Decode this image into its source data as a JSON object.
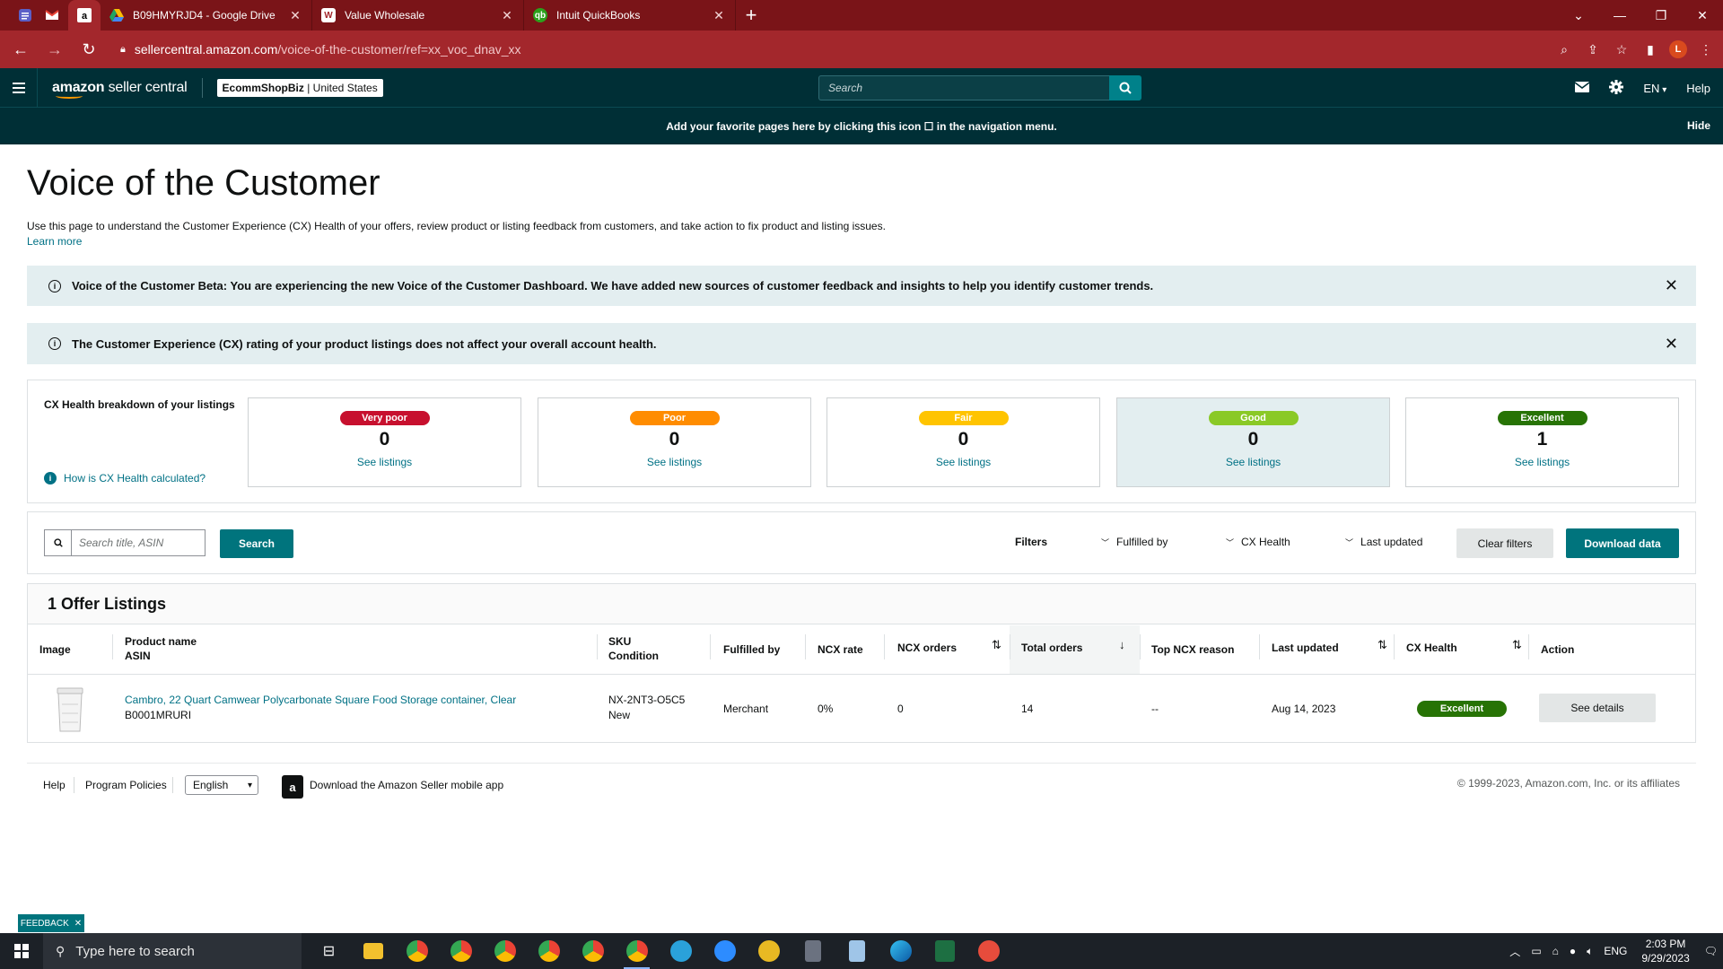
{
  "browser": {
    "tabs": [
      {
        "title": "B09HMYRJD4 - Google Drive",
        "icon": "google-drive-icon"
      },
      {
        "title": "Value Wholesale",
        "icon": "value-wholesale-icon"
      },
      {
        "title": "Intuit QuickBooks",
        "icon": "quickbooks-icon"
      }
    ],
    "url_domain": "sellercentral.amazon.com",
    "url_path": "/voice-of-the-customer/ref=xx_voc_dnav_xx",
    "profile_initial": "L"
  },
  "header": {
    "logo_text": "amazon",
    "logo_suffix": "seller central",
    "store_name": "EcommShopBiz",
    "store_region": "United States",
    "search_placeholder": "Search",
    "lang": "EN",
    "help": "Help"
  },
  "favbar": {
    "message": "Add your favorite pages here by clicking this icon ☐ in the navigation menu.",
    "hide": "Hide"
  },
  "page": {
    "title": "Voice of the Customer",
    "description": "Use this page to understand the Customer Experience (CX) Health of your offers, review product or listing feedback from customers, and take action to fix product and listing issues.",
    "learn_more": "Learn more"
  },
  "alerts": [
    {
      "text": "Voice of the Customer Beta: You are experiencing the new Voice of the Customer Dashboard. We have added new sources of customer feedback and insights to help you identify customer trends."
    },
    {
      "text": "The Customer Experience (CX) rating of your product listings does not affect your overall account health."
    }
  ],
  "cx_breakdown": {
    "label": "CX Health breakdown of your listings",
    "how_link": "How is CX Health calculated?",
    "cards": [
      {
        "badge": "Very poor",
        "count": "0",
        "link": "See listings",
        "color": "#c7102e"
      },
      {
        "badge": "Poor",
        "count": "0",
        "link": "See listings",
        "color": "#ff8c00"
      },
      {
        "badge": "Fair",
        "count": "0",
        "link": "See listings",
        "color": "#ffc400"
      },
      {
        "badge": "Good",
        "count": "0",
        "link": "See listings",
        "color": "#8ac926"
      },
      {
        "badge": "Excellent",
        "count": "1",
        "link": "See listings",
        "color": "#277305"
      }
    ]
  },
  "filters": {
    "search_placeholder": "Search title, ASIN",
    "search_button": "Search",
    "label": "Filters",
    "dropdowns": [
      "Fulfilled by",
      "CX Health",
      "Last updated"
    ],
    "clear": "Clear filters",
    "download": "Download data"
  },
  "table": {
    "title": "1 Offer Listings",
    "columns": {
      "image": "Image",
      "product": "Product name",
      "asin": "ASIN",
      "sku": "SKU",
      "condition": "Condition",
      "fulfilled": "Fulfilled by",
      "ncx_rate": "NCX rate",
      "ncx_orders": "NCX orders",
      "total_orders": "Total orders",
      "top_reason": "Top NCX reason",
      "last_updated": "Last updated",
      "cx_health": "CX Health",
      "action": "Action"
    },
    "rows": [
      {
        "product_name": "Cambro, 22 Quart Camwear Polycarbonate Square Food Storage container, Clear",
        "asin": "B0001MRURI",
        "sku": "NX-2NT3-O5C5",
        "condition": "New",
        "fulfilled_by": "Merchant",
        "ncx_rate": "0%",
        "ncx_orders": "0",
        "total_orders": "14",
        "top_reason": "--",
        "last_updated": "Aug 14, 2023",
        "cx_health": "Excellent",
        "action": "See details"
      }
    ]
  },
  "footer": {
    "help": "Help",
    "policies": "Program Policies",
    "language": "English",
    "app": "Download the Amazon Seller mobile app",
    "copyright": "© 1999-2023, Amazon.com, Inc. or its affiliates"
  },
  "feedback": "FEEDBACK",
  "taskbar": {
    "search_placeholder": "Type here to search",
    "lang": "ENG",
    "time": "2:03 PM",
    "date": "9/29/2023"
  }
}
